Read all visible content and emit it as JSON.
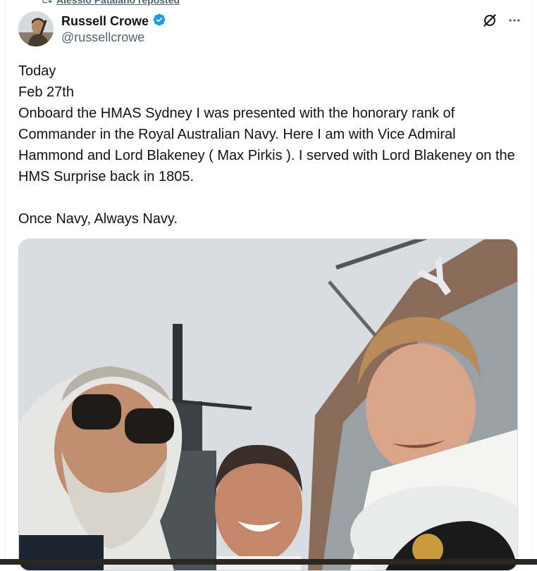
{
  "repost": {
    "text": "Alessio Patalano reposted"
  },
  "author": {
    "name": "Russell Crowe",
    "handle": "@russellcrowe",
    "verified": true
  },
  "post": {
    "lines": [
      "Today",
      "Feb 27th",
      "Onboard the HMAS Sydney I was presented with the honorary rank of Commander in the Royal Australian Navy. Here I am with Vice Admiral Hammond and Lord Blakeney ( Max Pirkis ). I served with Lord Blakeney on the HMS Surprise back in 1805.",
      "",
      "Once Navy, Always Navy."
    ]
  },
  "icons": {
    "grok": "grok-icon",
    "more": "more-icon",
    "repost": "repost-icon",
    "verified": "verified-badge-icon"
  },
  "colors": {
    "verified": "#1d9bf0",
    "muted": "#536471",
    "text": "#0f1419"
  }
}
